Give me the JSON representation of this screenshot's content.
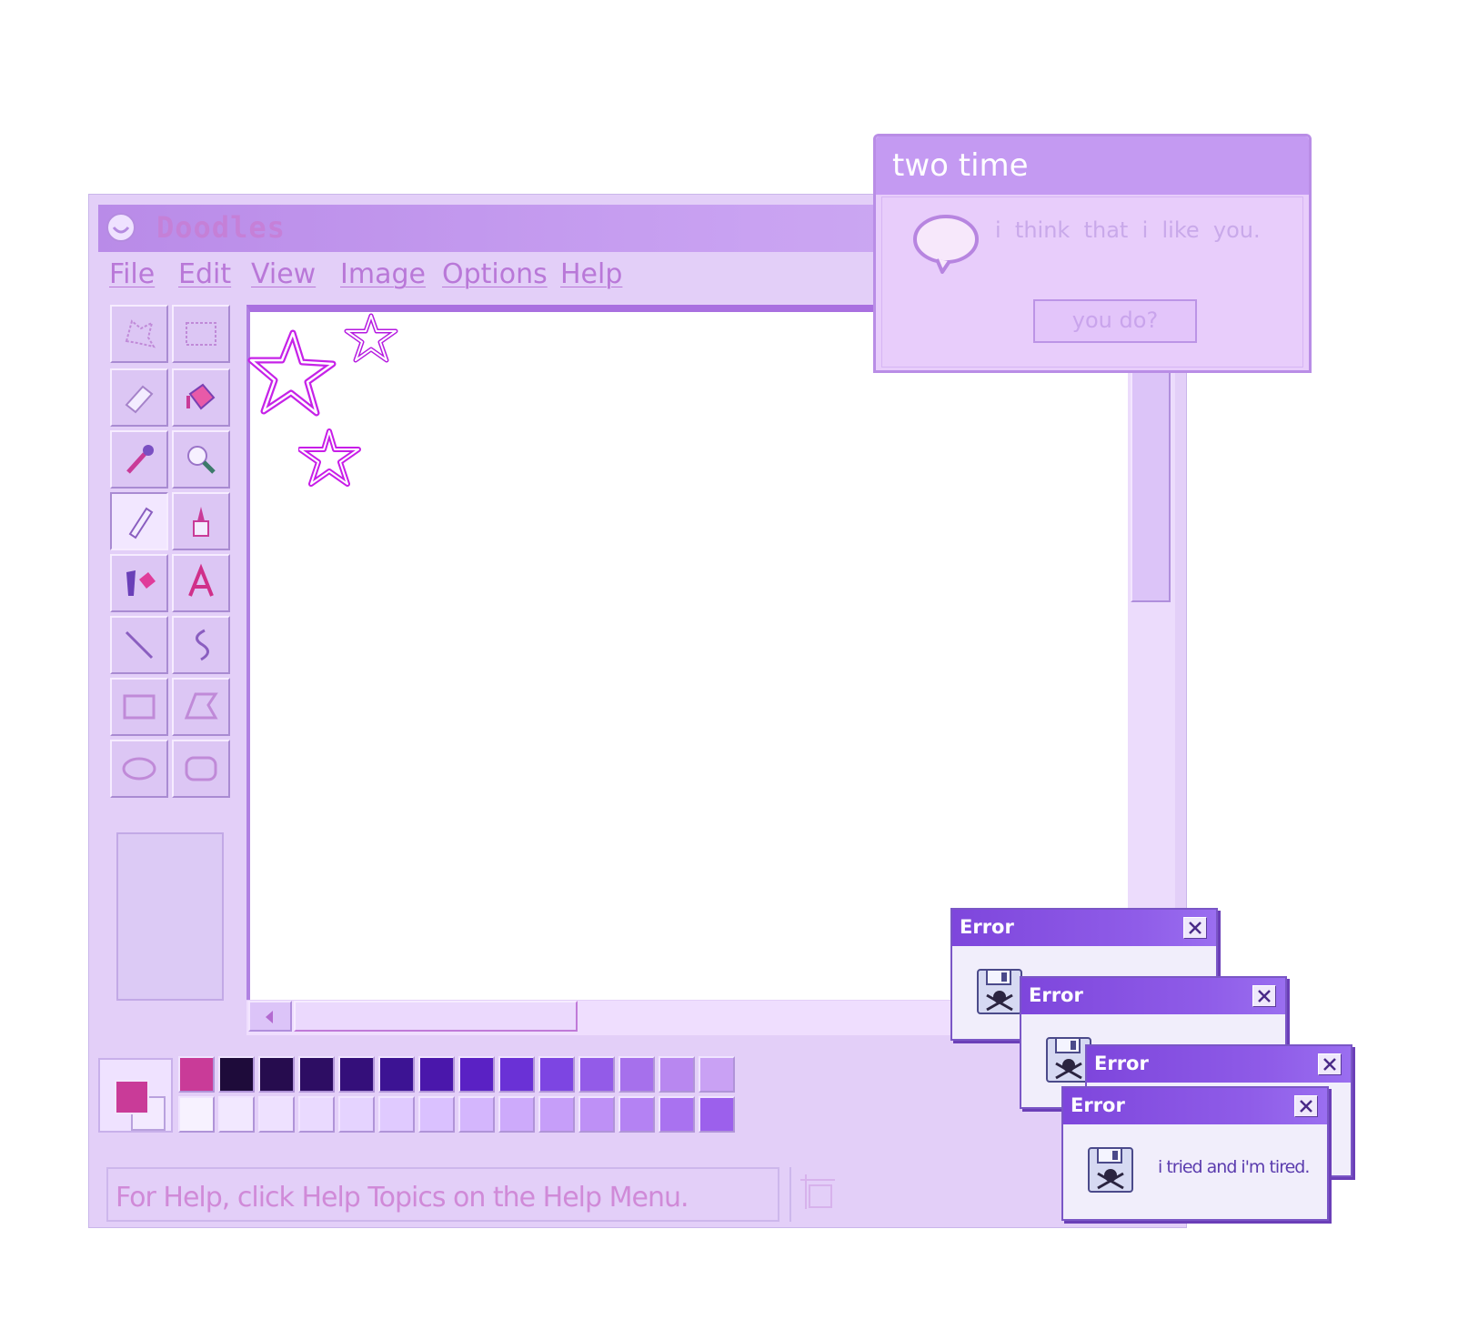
{
  "paint": {
    "title": "Doodles",
    "menu": [
      "File",
      "Edit",
      "View",
      "Image",
      "Options",
      "Help"
    ],
    "tools": [
      "free-form-select",
      "select",
      "eraser",
      "fill-with-color",
      "pick-color",
      "magnifier",
      "pencil",
      "brush",
      "airbrush",
      "text",
      "line",
      "curve",
      "rectangle",
      "polygon",
      "ellipse",
      "rounded-rectangle"
    ],
    "selected_tool": "pencil",
    "current_color": "#c93b98",
    "palette_top": [
      "#c93b98",
      "#1e0b3a",
      "#260c4e",
      "#2d0d63",
      "#340f7a",
      "#3c1393",
      "#4a17ab",
      "#5a21c4",
      "#6a31d6",
      "#7d45e2",
      "#935be8",
      "#a670ec",
      "#b887f0",
      "#c9a1f4"
    ],
    "palette_bottom": [
      "#f7f2ff",
      "#f2e8ff",
      "#eee1ff",
      "#eadaff",
      "#e5d3ff",
      "#e0caff",
      "#dac1ff",
      "#d4b6fd",
      "#cdaafb",
      "#c69ef9",
      "#be90f6",
      "#b482f3",
      "#a972f0",
      "#9c60ec"
    ],
    "status_text": "For Help, click Help Topics on the Help Menu."
  },
  "message": {
    "title": "two time",
    "text": "i  think  that  i  like  you.",
    "button": "you do?"
  },
  "errors": [
    {
      "title": "Error",
      "message": ""
    },
    {
      "title": "Error",
      "message": ""
    },
    {
      "title": "Error",
      "message": ""
    },
    {
      "title": "Error",
      "message": "i tried and i'm tired."
    }
  ]
}
